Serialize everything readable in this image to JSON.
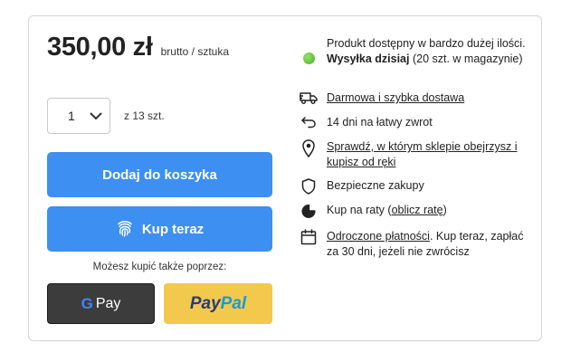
{
  "price": {
    "amount": "350,00 zł",
    "note": "brutto / sztuka"
  },
  "quantity": {
    "value": "1",
    "stock": "z 13 szt."
  },
  "buttons": {
    "add_to_cart": "Dodaj do koszyka",
    "buy_now": "Kup teraz",
    "alt_label": "Możesz kupić także poprzez:",
    "gpay_g": "G",
    "gpay_pay": "Pay",
    "paypal_pay": "Pay",
    "paypal_pal": "Pal"
  },
  "features": {
    "availability": {
      "pre": "Produkt dostępny w bardzo dużej ilości. ",
      "bold": "Wysyłka dzisiaj",
      "post": " (20 szt. w magazynie)",
      "icon": "green-dot-icon"
    },
    "delivery": {
      "link": "Darmowa i szybka dostawa",
      "icon": "truck-icon"
    },
    "returns": {
      "text": "14 dni na łatwy zwrot",
      "icon": "return-arrow-icon"
    },
    "stores": {
      "link": "Sprawdź, w którym sklepie obejrzysz i kupisz od ręki",
      "icon": "map-pin-icon"
    },
    "secure": {
      "text": "Bezpieczne zakupy",
      "icon": "shield-icon"
    },
    "installments": {
      "pre": "Kup na raty (",
      "link": "oblicz ratę",
      "post": ")",
      "icon": "pie-chart-icon"
    },
    "deferred": {
      "link": "Odroczone płatności",
      "post": ". Kup teraz, zapłać za 30 dni, jeżeli nie zwrócisz",
      "icon": "calendar-icon"
    }
  },
  "colors": {
    "primary": "#3d8ff2",
    "paypal_bg": "#f2c94c",
    "gpay_bg": "#3c3c3c",
    "available": "#5cbf2a"
  }
}
